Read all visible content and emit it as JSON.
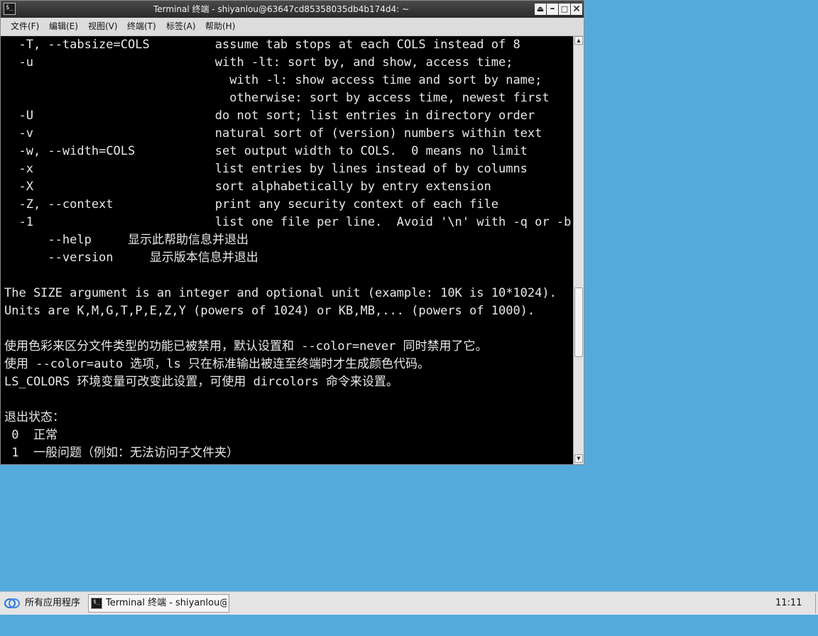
{
  "window": {
    "title": "Terminal 终端 - shiyanlou@63647cd85358035db4b174d4: ~",
    "app_icon": "terminal-icon",
    "controls": {
      "shade": "⏏",
      "minimize": "–",
      "maximize": "□",
      "close": "✕"
    }
  },
  "menu": {
    "items": [
      {
        "label": "文件(F)"
      },
      {
        "label": "编辑(E)"
      },
      {
        "label": "视图(V)"
      },
      {
        "label": "终端(T)"
      },
      {
        "label": "标签(A)"
      },
      {
        "label": "帮助(H)"
      }
    ]
  },
  "terminal": {
    "background": "#000000",
    "foreground": "#e8e8e8",
    "lines": [
      "  -T, --tabsize=COLS         assume tab stops at each COLS instead of 8",
      "  -u                         with -lt: sort by, and show, access time;",
      "                               with -l: show access time and sort by name;",
      "                               otherwise: sort by access time, newest first",
      "  -U                         do not sort; list entries in directory order",
      "  -v                         natural sort of (version) numbers within text",
      "  -w, --width=COLS           set output width to COLS.  0 means no limit",
      "  -x                         list entries by lines instead of by columns",
      "  -X                         sort alphabetically by entry extension",
      "  -Z, --context              print any security context of each file",
      "  -1                         list one file per line.  Avoid '\\n' with -q or -b",
      "      --help     显示此帮助信息并退出",
      "      --version     显示版本信息并退出",
      "",
      "The SIZE argument is an integer and optional unit (example: 10K is 10*1024).",
      "Units are K,M,G,T,P,E,Z,Y (powers of 1024) or KB,MB,... (powers of 1000).",
      "",
      "使用色彩来区分文件类型的功能已被禁用，默认设置和 --color=never 同时禁用了它。",
      "使用 --color=auto 选项，ls 只在标准输出被连至终端时才生成颜色代码。",
      "LS_COLORS 环境变量可改变此设置，可使用 dircolors 命令来设置。",
      "",
      "退出状态：",
      " 0  正常",
      " 1  一般问题（例如：无法访问子文件夹）"
    ]
  },
  "scrollbar": {
    "position_fraction": 0.71
  },
  "taskbar": {
    "start_label": "所有应用程序",
    "start_icon": "app-menu-icon",
    "tasks": [
      {
        "label": "Terminal 终端 - shiyanlou@···",
        "icon": "terminal-icon"
      }
    ],
    "clock": "11:11"
  },
  "colors": {
    "desktop": "#55aadc",
    "titlebar": "#333333",
    "taskbar": "#e4e4e4"
  }
}
